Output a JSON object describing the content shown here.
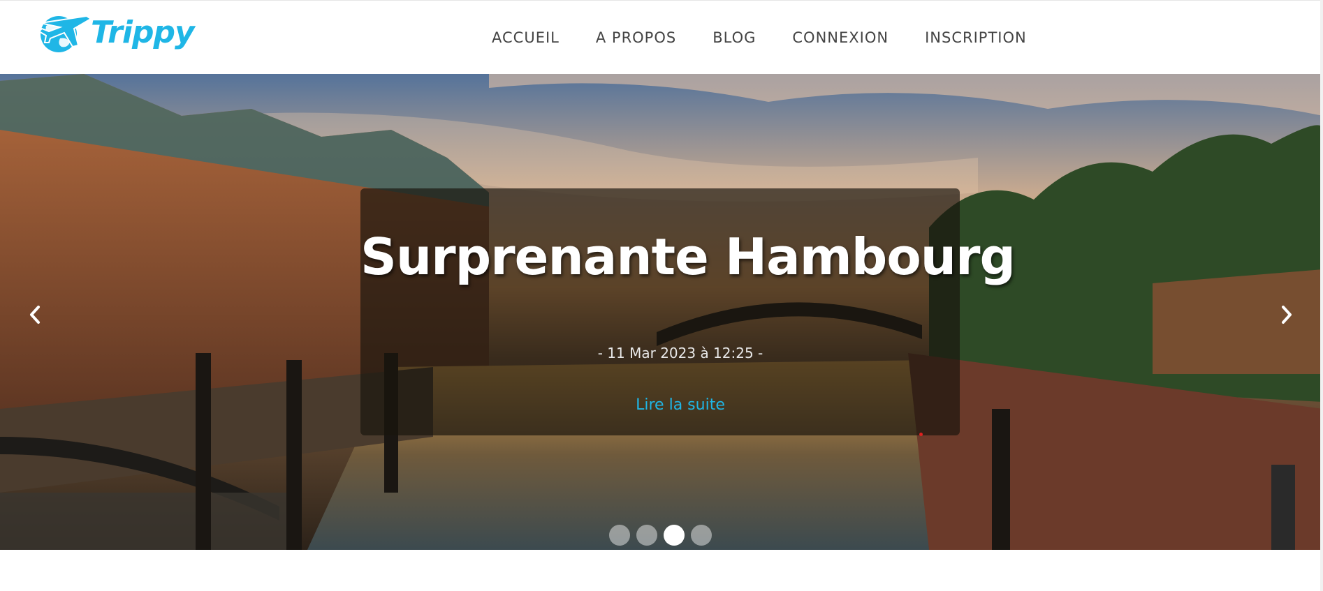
{
  "brand": {
    "name": "Trippy",
    "icon": "airplane-globe-icon",
    "color": "#1fb6e6"
  },
  "nav": {
    "items": [
      {
        "label": "ACCUEIL"
      },
      {
        "label": "A PROPOS"
      },
      {
        "label": "BLOG"
      },
      {
        "label": "CONNEXION"
      },
      {
        "label": "INSCRIPTION"
      }
    ]
  },
  "carousel": {
    "slide": {
      "title": "Surprenante Hambourg",
      "date": "- 11 Mar 2023 à 12:25 -",
      "link_label": "Lire la suite"
    },
    "prev_icon": "chevron-left-icon",
    "next_icon": "chevron-right-icon",
    "indicator_count": 4,
    "active_index": 2
  }
}
